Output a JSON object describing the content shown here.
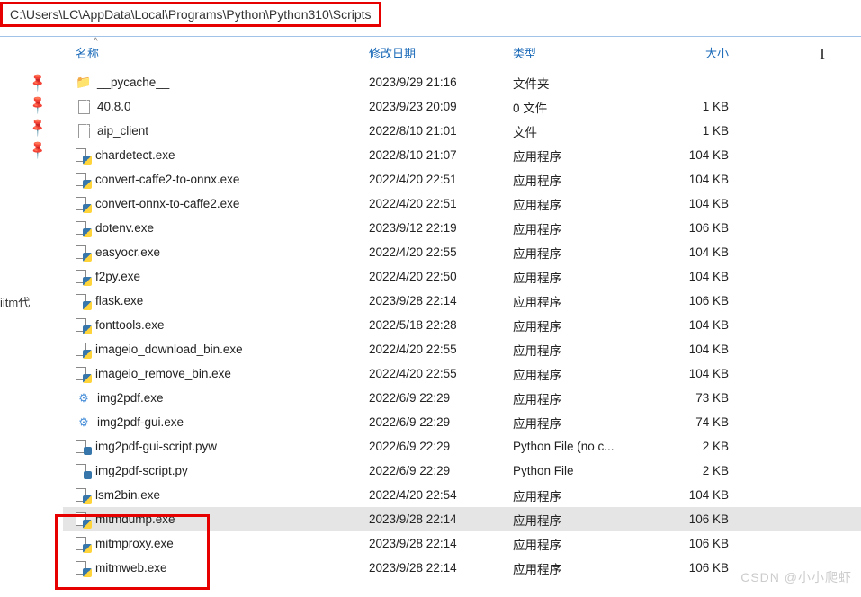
{
  "address_bar": "C:\\Users\\LC\\AppData\\Local\\Programs\\Python\\Python310\\Scripts",
  "left_label": "iitm代",
  "cursor_mark": "I",
  "watermark": "CSDN @小小爬虾",
  "columns": {
    "name": "名称",
    "date": "修改日期",
    "type": "类型",
    "size": "大小"
  },
  "sort_indicator": "^",
  "files": [
    {
      "icon": "folder",
      "name": "__pycache__",
      "date": "2023/9/29 21:16",
      "type": "文件夹",
      "size": ""
    },
    {
      "icon": "blank",
      "name": "40.8.0",
      "date": "2023/9/23 20:09",
      "type": "0 文件",
      "size": "1 KB"
    },
    {
      "icon": "blank",
      "name": "aip_client",
      "date": "2022/8/10 21:01",
      "type": "文件",
      "size": "1 KB"
    },
    {
      "icon": "exe",
      "name": "chardetect.exe",
      "date": "2022/8/10 21:07",
      "type": "应用程序",
      "size": "104 KB"
    },
    {
      "icon": "exe",
      "name": "convert-caffe2-to-onnx.exe",
      "date": "2022/4/20 22:51",
      "type": "应用程序",
      "size": "104 KB"
    },
    {
      "icon": "exe",
      "name": "convert-onnx-to-caffe2.exe",
      "date": "2022/4/20 22:51",
      "type": "应用程序",
      "size": "104 KB"
    },
    {
      "icon": "exe",
      "name": "dotenv.exe",
      "date": "2023/9/12 22:19",
      "type": "应用程序",
      "size": "106 KB"
    },
    {
      "icon": "exe",
      "name": "easyocr.exe",
      "date": "2022/4/20 22:55",
      "type": "应用程序",
      "size": "104 KB"
    },
    {
      "icon": "exe",
      "name": "f2py.exe",
      "date": "2022/4/20 22:50",
      "type": "应用程序",
      "size": "104 KB"
    },
    {
      "icon": "exe",
      "name": "flask.exe",
      "date": "2023/9/28 22:14",
      "type": "应用程序",
      "size": "106 KB"
    },
    {
      "icon": "exe",
      "name": "fonttools.exe",
      "date": "2022/5/18 22:28",
      "type": "应用程序",
      "size": "104 KB"
    },
    {
      "icon": "exe",
      "name": "imageio_download_bin.exe",
      "date": "2022/4/20 22:55",
      "type": "应用程序",
      "size": "104 KB"
    },
    {
      "icon": "exe",
      "name": "imageio_remove_bin.exe",
      "date": "2022/4/20 22:55",
      "type": "应用程序",
      "size": "104 KB"
    },
    {
      "icon": "settings",
      "name": "img2pdf.exe",
      "date": "2022/6/9 22:29",
      "type": "应用程序",
      "size": "73 KB"
    },
    {
      "icon": "settings",
      "name": "img2pdf-gui.exe",
      "date": "2022/6/9 22:29",
      "type": "应用程序",
      "size": "74 KB"
    },
    {
      "icon": "py",
      "name": "img2pdf-gui-script.pyw",
      "date": "2022/6/9 22:29",
      "type": "Python File (no c...",
      "size": "2 KB"
    },
    {
      "icon": "py",
      "name": "img2pdf-script.py",
      "date": "2022/6/9 22:29",
      "type": "Python File",
      "size": "2 KB"
    },
    {
      "icon": "exe",
      "name": "lsm2bin.exe",
      "date": "2022/4/20 22:54",
      "type": "应用程序",
      "size": "104 KB"
    },
    {
      "icon": "exe",
      "name": "mitmdump.exe",
      "date": "2023/9/28 22:14",
      "type": "应用程序",
      "size": "106 KB",
      "selected": true
    },
    {
      "icon": "exe",
      "name": "mitmproxy.exe",
      "date": "2023/9/28 22:14",
      "type": "应用程序",
      "size": "106 KB"
    },
    {
      "icon": "exe",
      "name": "mitmweb.exe",
      "date": "2023/9/28 22:14",
      "type": "应用程序",
      "size": "106 KB"
    }
  ]
}
